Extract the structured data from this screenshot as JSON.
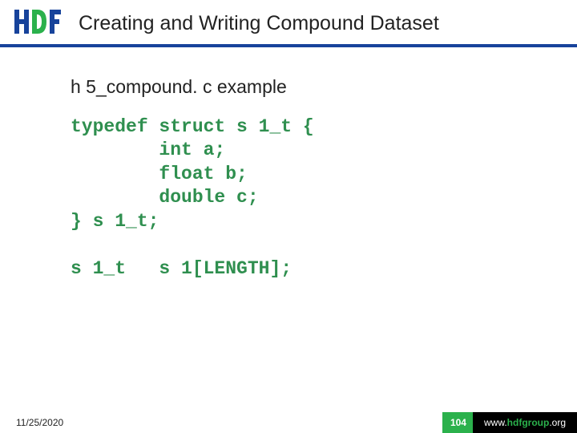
{
  "header": {
    "title": "Creating and Writing Compound Dataset"
  },
  "body": {
    "subtitle": "h 5_compound. c example",
    "code": "typedef struct s 1_t {\n        int a;\n        float b;\n        double c;\n} s 1_t;\n\ns 1_t   s 1[LENGTH];"
  },
  "footer": {
    "date": "11/25/2020",
    "page": "104",
    "brand_www": "www.",
    "brand_hdf": "hdfgroup",
    "brand_org": ".org"
  },
  "logo": {
    "name": "hdf-logo"
  }
}
